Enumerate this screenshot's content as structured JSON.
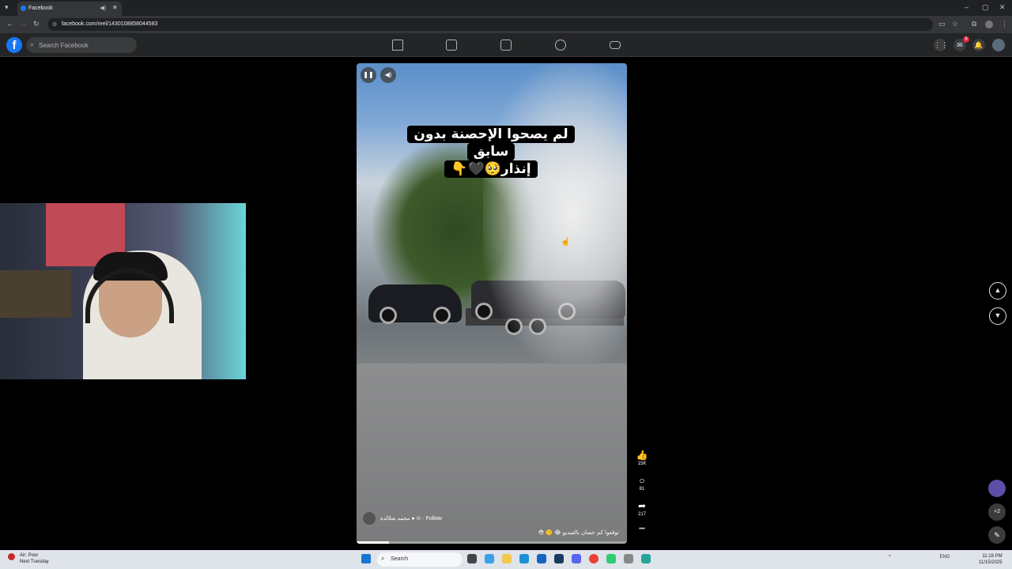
{
  "browser": {
    "tab_title": "Facebook",
    "url": "facebook.com/reel/1430108858044583",
    "new_tab": "+",
    "minimize": "–",
    "maximize": "▢",
    "close": "✕"
  },
  "fb_header": {
    "logo": "f",
    "search_placeholder": "Search Facebook",
    "notification_count": "8"
  },
  "reel": {
    "caption_line1": "لم يصحوا الإحصنة بدون سابق",
    "caption_line2": "إنذار🥺🖤👇",
    "author": "محمد شلالدة ● ⊙ · Follow",
    "description": "توقعوا كم حصان بالفيديو 😂 🤫 😳",
    "progress_fraction": 0.12
  },
  "actions": {
    "likes": "15K",
    "comments": "81",
    "shares": "217",
    "more": "•••"
  },
  "floating": {
    "plus_badge": "+2"
  },
  "taskbar": {
    "weather_title": "Air: Poor",
    "weather_sub": "Next Tuesday",
    "search": "Search",
    "lang": "ENG",
    "time": "11:16 PM",
    "date": "11/15/2025"
  }
}
